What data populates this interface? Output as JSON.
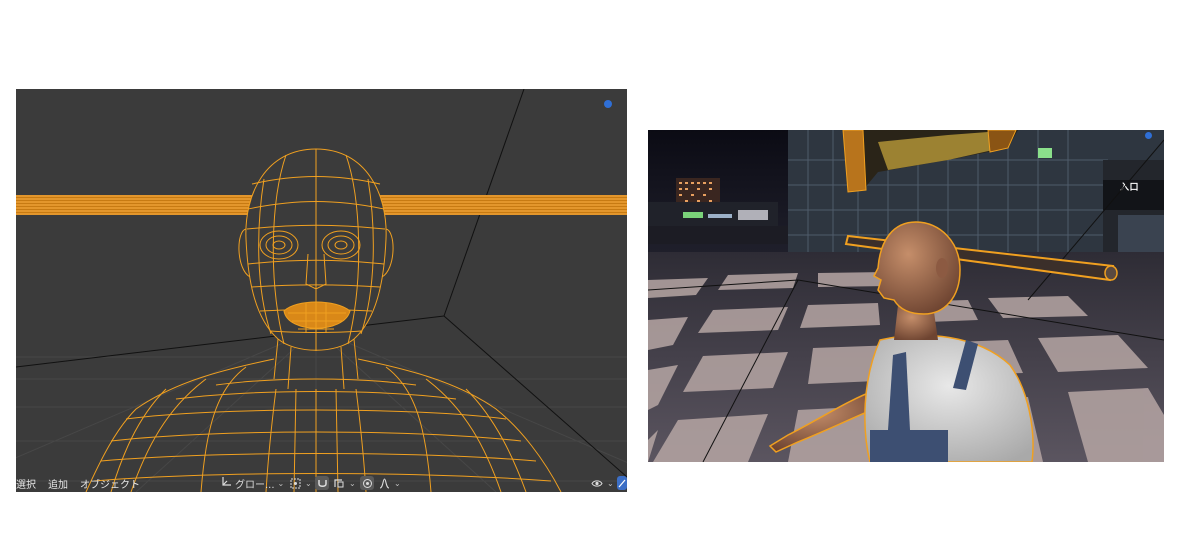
{
  "left_viewport": {
    "header_menu": [
      {
        "id": "select",
        "label": "選択"
      },
      {
        "id": "add",
        "label": "追加"
      },
      {
        "id": "object",
        "label": "オブジェクト"
      }
    ],
    "transform_orientation": {
      "value": "グロー..."
    },
    "icons": {
      "orientation": "axes-icon",
      "pivot": "pivot-point-icon",
      "snap": "magnet-icon",
      "snap_target": "snap-increment-icon",
      "proportional": "proportional-edit-icon",
      "falloff": "falloff-curve-icon",
      "visibility": "eye-icon",
      "view_toggle": "navigation-icon",
      "indicator": "blue-dot-icon"
    },
    "colors": {
      "background": "#3b3b3b",
      "wire": "#f0a020",
      "grid": "#4c4c4c"
    }
  },
  "right_render": {
    "sign_text": "入口",
    "colors": {
      "outline": "#f0a020",
      "floor_light": "#b8a8a4",
      "floor_dark": "#4b4850"
    }
  }
}
